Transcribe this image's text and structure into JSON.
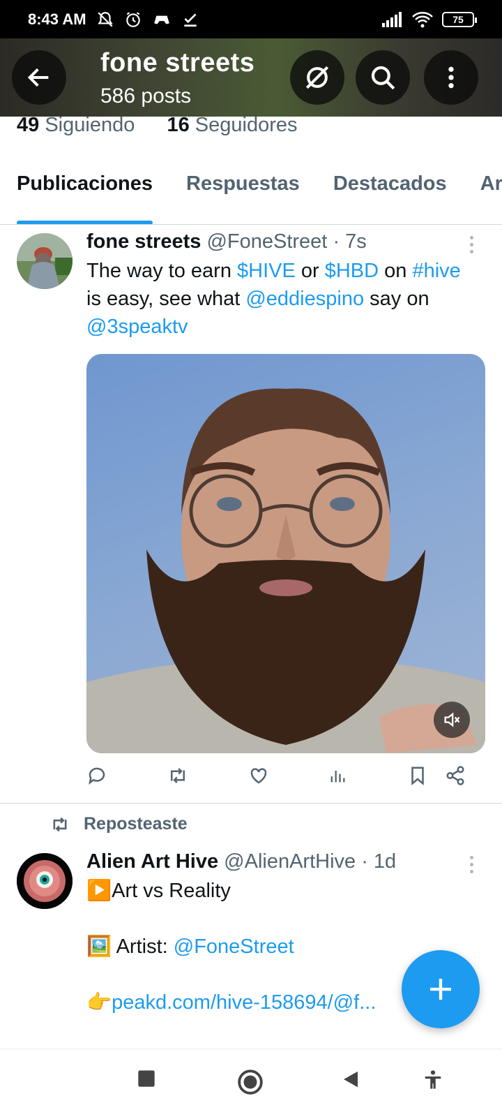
{
  "status_bar": {
    "time": "8:43 AM",
    "battery": "75",
    "icons": [
      "notifications-off-icon",
      "alarm-icon",
      "game-icon",
      "check-icon",
      "signal-icon",
      "wifi-icon",
      "battery-icon"
    ]
  },
  "header": {
    "title": "fone streets",
    "subtitle": "586 posts",
    "buttons": [
      "back-arrow-icon",
      "grok-icon",
      "search-icon",
      "more-icon"
    ]
  },
  "profile": {
    "following_count": "49",
    "following_label": "Siguiendo",
    "followers_count": "16",
    "followers_label": "Seguidores"
  },
  "tabs": [
    {
      "label": "Publicaciones",
      "active": true
    },
    {
      "label": "Respuestas",
      "active": false
    },
    {
      "label": "Destacados",
      "active": false
    },
    {
      "label": "Artículos",
      "active": false
    }
  ],
  "tweet1": {
    "name": "fone streets",
    "handle": "@FoneStreet",
    "time": "· 7s",
    "text": {
      "t1": "The way to earn ",
      "l1": "$HIVE",
      "t2": " or ",
      "l2": "$HBD",
      "t3": " on ",
      "l3": "#hive",
      "t4": "is easy, see what ",
      "l4": "@eddiespino",
      "t5": " say on",
      "l5": "@3speaktv"
    },
    "media_mute_icon": "volume-mute-icon"
  },
  "actions": [
    "reply-icon",
    "repost-icon",
    "like-icon",
    "views-icon",
    "bookmark-icon",
    "share-icon"
  ],
  "repost_label": "Reposteaste",
  "tweet2": {
    "name": "Alien Art Hive",
    "handle": "@AlienArtHive",
    "time": "· 1d",
    "line1_emoji": "▶️",
    "line1": "Art vs Reality",
    "line2_emoji": "🖼️",
    "line2_label": " Artist: ",
    "line2_link": "@FoneStreet",
    "line3_emoji": "👉",
    "line3_link": "peakd.com/hive-158694/@f..."
  },
  "fab_icon": "plus-icon",
  "nav_buttons": [
    "recents-icon",
    "home-icon",
    "back-icon",
    "accessibility-icon"
  ],
  "colors": {
    "accent": "#1d9bf0",
    "text": "#0f1419",
    "secondary": "#536471"
  }
}
